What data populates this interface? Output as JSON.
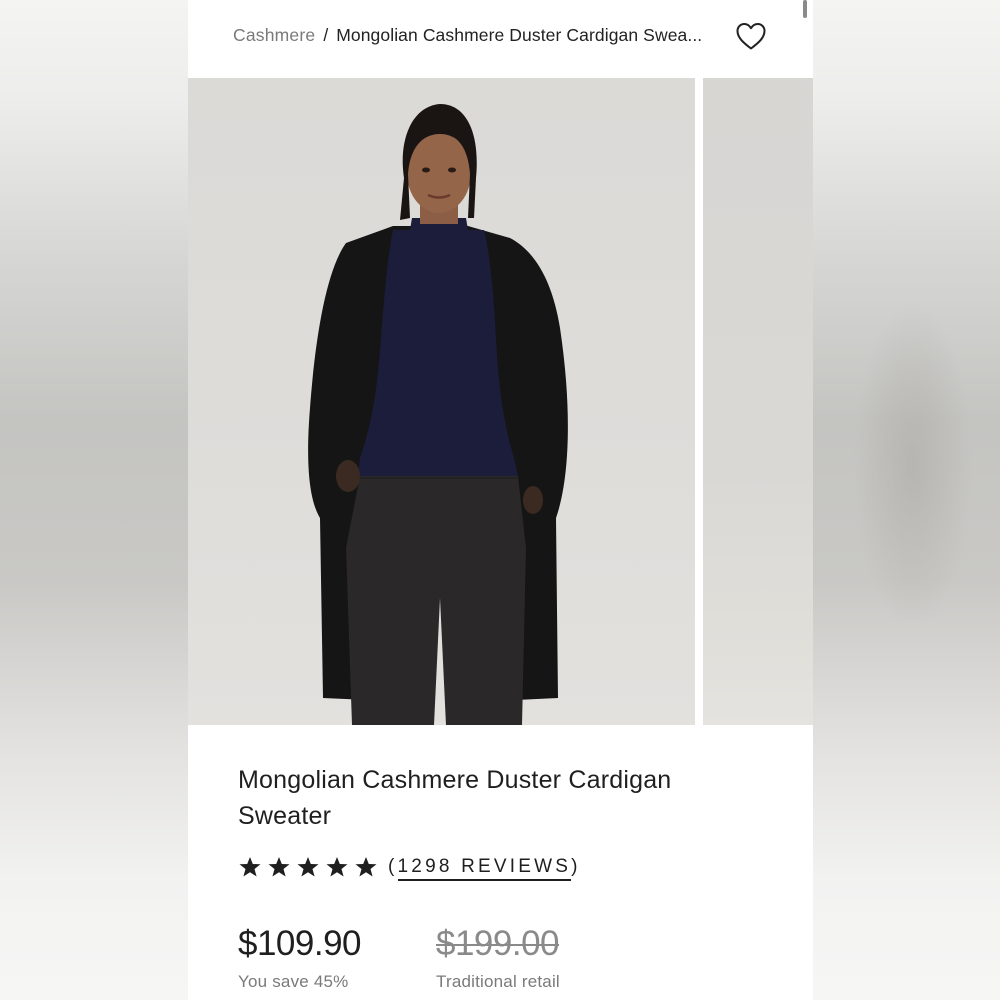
{
  "breadcrumb": {
    "parent": "Cashmere",
    "separator": "/",
    "current": "Mongolian Cashmere Duster Cardigan Swea..."
  },
  "wishlist": {
    "icon": "heart-outline-icon"
  },
  "gallery": {
    "images": [
      {
        "alt": "Model wearing black cashmere duster cardigan over navy ribbed turtleneck with dark trousers"
      },
      {
        "alt": "Next product image partially visible"
      }
    ]
  },
  "product": {
    "title_line1": "Mongolian Cashmere Duster Cardigan",
    "title_line2": "Sweater",
    "rating": {
      "stars": 5,
      "max": 5,
      "icon": "star-icon"
    },
    "reviews_open": "(",
    "reviews_label": "1298 REVIEWS",
    "reviews_close": ")",
    "price": "$109.90",
    "savings": "You save 45%",
    "retail_price": "$199.00",
    "retail_label": "Traditional retail"
  },
  "colors": {
    "text": "#1f1f1f",
    "muted": "#7a7a7a",
    "background": "#ffffff"
  }
}
